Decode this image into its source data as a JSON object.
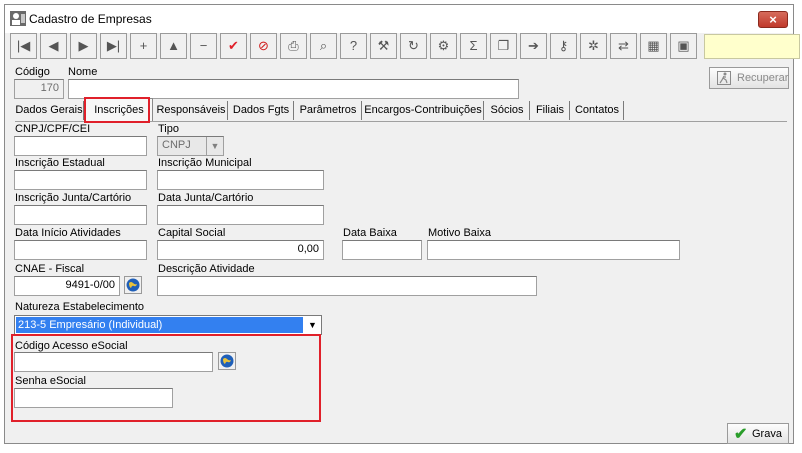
{
  "window": {
    "title": "Cadastro de Empresas",
    "close_label": "×"
  },
  "toolbar": {
    "buttons": [
      {
        "name": "first-record-button",
        "glyph": "|◀"
      },
      {
        "name": "prev-record-button",
        "glyph": "◀"
      },
      {
        "name": "next-record-button",
        "glyph": "▶"
      },
      {
        "name": "last-record-button",
        "glyph": "▶|"
      },
      {
        "name": "add-button",
        "glyph": "+"
      },
      {
        "name": "up-button",
        "glyph": "▲"
      },
      {
        "name": "remove-button",
        "glyph": "−"
      },
      {
        "name": "confirm-button",
        "glyph": "✔"
      },
      {
        "name": "cancel-button",
        "glyph": "⊘"
      },
      {
        "name": "print-button",
        "glyph": "⎙"
      },
      {
        "name": "key-search-button",
        "glyph": "⌕"
      },
      {
        "name": "query-button",
        "glyph": "?"
      },
      {
        "name": "tools-button",
        "glyph": "⚒"
      },
      {
        "name": "refresh-button",
        "glyph": "↻"
      },
      {
        "name": "config-button",
        "glyph": "⚙"
      },
      {
        "name": "sum-button",
        "glyph": "Σ"
      },
      {
        "name": "copy-button",
        "glyph": "❐"
      },
      {
        "name": "export-button",
        "glyph": "➔"
      },
      {
        "name": "key-button",
        "glyph": "⚷"
      },
      {
        "name": "settings-button",
        "glyph": "✲"
      },
      {
        "name": "transfer-button",
        "glyph": "⇄"
      },
      {
        "name": "calculator-button",
        "glyph": "▦"
      },
      {
        "name": "stop-button",
        "glyph": "▣"
      }
    ]
  },
  "header": {
    "codigo_label": "Código",
    "codigo_value": "170",
    "nome_label": "Nome",
    "nome_value": "",
    "recuperar_label": "Recuperar"
  },
  "tabs": [
    {
      "label": "Dados Gerais",
      "active": false
    },
    {
      "label": "Inscrições",
      "active": true
    },
    {
      "label": "Responsáveis",
      "active": false
    },
    {
      "label": "Dados Fgts",
      "active": false
    },
    {
      "label": "Parâmetros",
      "active": false
    },
    {
      "label": "Encargos-Contribuições",
      "active": false
    },
    {
      "label": "Sócios",
      "active": false
    },
    {
      "label": "Filiais",
      "active": false
    },
    {
      "label": "Contatos",
      "active": false
    }
  ],
  "form": {
    "cnpj_label": "CNPJ/CPF/CEI",
    "cnpj_value": "",
    "tipo_label": "Tipo",
    "tipo_value": "CNPJ",
    "ie_label": "Inscrição Estadual",
    "ie_value": "",
    "im_label": "Inscrição Municipal",
    "im_value": "",
    "ijc_label": "Inscrição Junta/Cartório",
    "ijc_value": "",
    "djc_label": "Data Junta/Cartório",
    "djc_value": "",
    "dia_label": "Data Início Atividades",
    "dia_value": "",
    "capital_label": "Capital Social",
    "capital_value": "0,00",
    "baixa_label": "Data Baixa",
    "baixa_value": "",
    "motivo_label": "Motivo Baixa",
    "motivo_value": "",
    "cnae_label": "CNAE - Fiscal",
    "cnae_value": "9491-0/00",
    "desc_label": "Descrição Atividade",
    "desc_value": "",
    "natureza_label": "Natureza Estabelecimento",
    "natureza_value": "213-5 Empresário (Individual)",
    "esocial_code_label": "Código Acesso eSocial",
    "esocial_code_value": "",
    "esocial_pass_label": "Senha eSocial",
    "esocial_pass_value": ""
  },
  "footer": {
    "grava_label": "Grava"
  },
  "colors": {
    "highlight": "#e0202a",
    "selection": "#3380f0"
  }
}
